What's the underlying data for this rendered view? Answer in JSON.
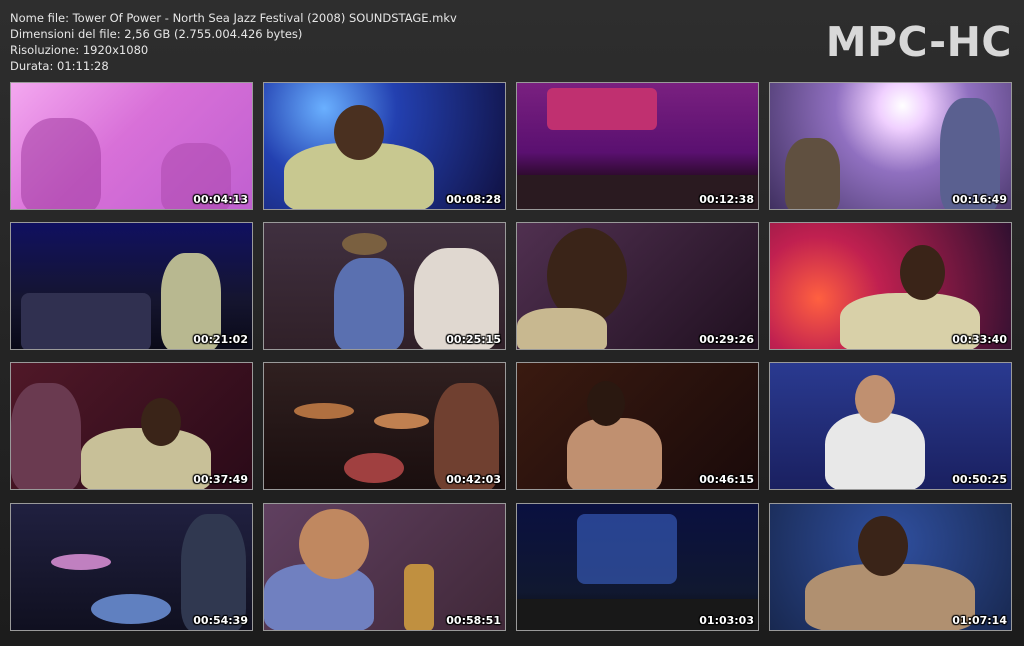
{
  "file_info": {
    "name_line": "Nome file: Tower Of Power - North Sea Jazz Festival (2008) SOUNDSTAGE.mkv",
    "size_line": "Dimensioni del file: 2,56 GB (2.755.004.426 bytes)",
    "resolution_line": "Risoluzione: 1920x1080",
    "duration_line": "Durata: 01:11:28"
  },
  "brand": "MPC-HC",
  "thumbnails": [
    {
      "time": "00:04:13",
      "scene": "pink-blurred-saxophonist"
    },
    {
      "time": "00:08:28",
      "scene": "singer-microphone-blue"
    },
    {
      "time": "00:12:38",
      "scene": "stage-wide-north-sea-jazz"
    },
    {
      "time": "00:16:49",
      "scene": "horn-section-spotlight"
    },
    {
      "time": "00:21:02",
      "scene": "band-line-blue-stage"
    },
    {
      "time": "00:25:15",
      "scene": "saxophone-section-hats"
    },
    {
      "time": "00:29:26",
      "scene": "singer-closeup-microphone"
    },
    {
      "time": "00:33:40",
      "scene": "singer-red-lights"
    },
    {
      "time": "00:37:49",
      "scene": "singer-crowd-red"
    },
    {
      "time": "00:42:03",
      "scene": "drummer-kit"
    },
    {
      "time": "00:46:15",
      "scene": "singer-dark-stage"
    },
    {
      "time": "00:50:25",
      "scene": "singer-blue-backdrop"
    },
    {
      "time": "00:54:39",
      "scene": "drummer-kit-blue"
    },
    {
      "time": "00:58:51",
      "scene": "saxophonist-closeup"
    },
    {
      "time": "01:03:03",
      "scene": "stage-wide-dark-blue"
    },
    {
      "time": "01:07:14",
      "scene": "singer-blue-spotlight"
    }
  ]
}
